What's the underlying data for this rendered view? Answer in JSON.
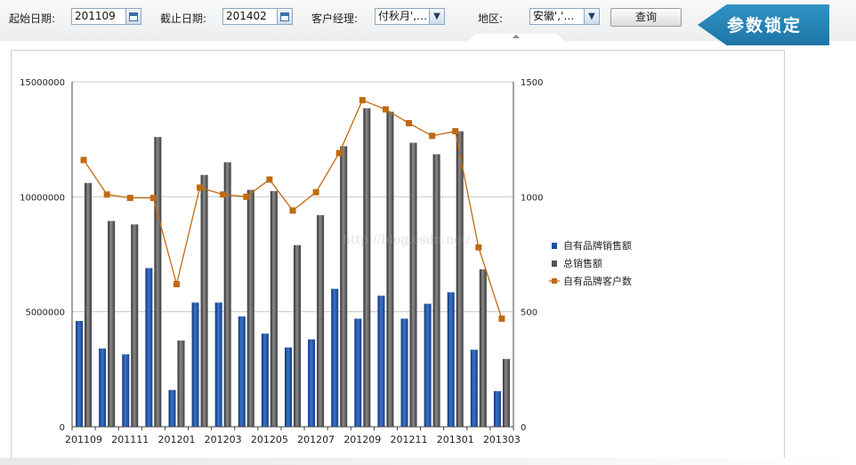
{
  "filters": {
    "start_label": "起始日期:",
    "start_value": "201109",
    "end_label": "截止日期:",
    "end_value": "201402",
    "manager_label": "客户经理:",
    "manager_value": "付秋月',…",
    "region_label": "地区:",
    "region_value": "安徽','…",
    "query_label": "查询"
  },
  "ribbon": {
    "text": "参数锁定"
  },
  "watermark": "http://blog.csdn.net/",
  "icons": [
    "calendar-icon",
    "chevron-down-icon",
    "caret-up-icon"
  ],
  "colors": {
    "own_brand_sales": "#1f4e9a",
    "total_sales": "#555555",
    "own_brand_customers": "#c06a10",
    "ribbon": "#2785b6"
  },
  "chart_data": {
    "type": "bar",
    "categories": [
      "201109",
      "201110",
      "201111",
      "201112",
      "201201",
      "201202",
      "201203",
      "201204",
      "201205",
      "201206",
      "201207",
      "201208",
      "201209",
      "201210",
      "201211",
      "201212",
      "201301",
      "201302",
      "201303"
    ],
    "x_tick_labels": [
      "201109",
      "201111",
      "201201",
      "201203",
      "201205",
      "201207",
      "201209",
      "201211",
      "201301",
      "201303"
    ],
    "series": [
      {
        "name": "自有品牌销售额",
        "type": "bar",
        "axis": "left",
        "values": [
          4600000,
          3400000,
          3150000,
          6900000,
          1600000,
          5400000,
          5400000,
          4800000,
          4050000,
          3450000,
          3800000,
          6000000,
          4700000,
          5700000,
          4700000,
          5350000,
          5850000,
          3350000,
          1550000
        ]
      },
      {
        "name": "总销售额",
        "type": "bar",
        "axis": "left",
        "values": [
          10600000,
          8950000,
          8800000,
          12600000,
          3750000,
          10950000,
          11500000,
          10300000,
          10250000,
          7900000,
          9200000,
          12200000,
          13850000,
          13700000,
          12350000,
          11850000,
          12850000,
          6850000,
          2950000
        ]
      },
      {
        "name": "自有品牌客户数",
        "type": "line",
        "axis": "right",
        "values": [
          1160,
          1010,
          995,
          995,
          620,
          1040,
          1010,
          1000,
          1075,
          940,
          1020,
          1190,
          1420,
          1380,
          1320,
          1265,
          1285,
          780,
          470
        ]
      }
    ],
    "left_axis": {
      "ticks": [
        "15000000",
        "10000000",
        "5000000",
        "0"
      ],
      "range": [
        0,
        15000000
      ]
    },
    "right_axis": {
      "ticks": [
        "1500",
        "1000",
        "500",
        "0"
      ],
      "range": [
        0,
        1500
      ]
    },
    "grid": true,
    "legend_position": "right"
  }
}
